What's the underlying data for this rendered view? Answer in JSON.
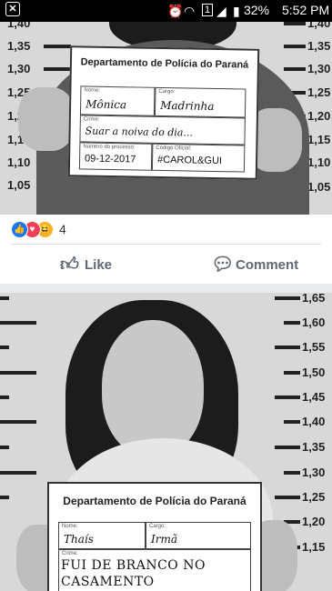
{
  "status_bar": {
    "notification_icon": "x-box-icon",
    "battery_percent": "32%",
    "time": "5:52 PM"
  },
  "post1": {
    "ruler_labels": [
      "1,40",
      "1,35",
      "1,30",
      "1,25",
      "1,20",
      "1,15",
      "1,10",
      "1,05"
    ],
    "right_ruler_labels": [
      "1,40",
      "1,35",
      "1,30",
      "1,25",
      "1,20",
      "1,15",
      "1,10",
      "1,05"
    ],
    "card": {
      "title": "Departamento de Polícia do Paraná",
      "name_label": "Nome:",
      "name_value": "Mônica",
      "role_label": "Cargo:",
      "role_value": "Madrinha",
      "crime_label": "Crime:",
      "crime_value": "Suar a noiva do dia...",
      "process_label": "Número do processo:",
      "process_value": "09-12-2017",
      "code_label": "Código Oficial:",
      "code_value": "#CAROL&GUI"
    }
  },
  "reactions": {
    "icons": [
      "like-icon",
      "love-icon",
      "haha-icon"
    ],
    "count": "4"
  },
  "actions": {
    "like_label": "Like",
    "comment_label": "Comment"
  },
  "post2": {
    "ruler_labels": [
      "1,65",
      "1,60",
      "1,55",
      "1,50",
      "1,45",
      "1,40",
      "1,35",
      "1,30",
      "1,25",
      "1,20",
      "1,15"
    ],
    "card": {
      "title": "Departamento de Polícia do Paraná",
      "name_label": "Nome:",
      "name_value": "Thaís",
      "role_label": "Cargo:",
      "role_value": "Irmã",
      "crime_label": "Crime:",
      "crime_value": "FUI DE BRANCO NO CASAMENTO"
    }
  }
}
